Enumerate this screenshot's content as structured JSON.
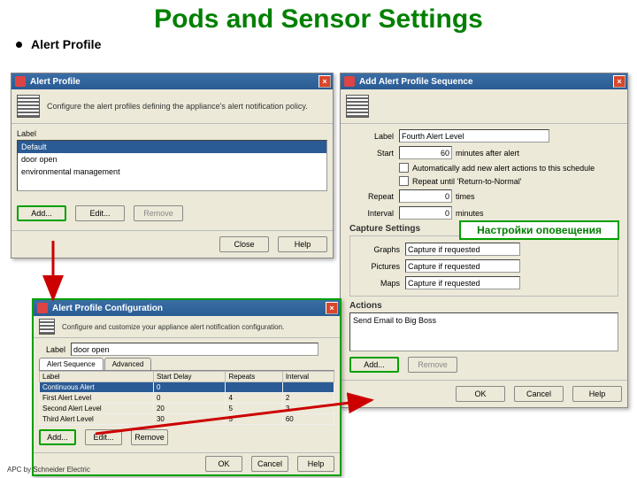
{
  "slide": {
    "title": "Pods and Sensor Settings",
    "bullet": "Alert Profile"
  },
  "footer": "APC by Schneider Electric",
  "annot": {
    "capture": "Настройки оповещения"
  },
  "win1": {
    "title": "Alert Profile",
    "desc": "Configure the alert profiles defining the appliance's alert notification policy.",
    "label_heading": "Label",
    "rows": [
      "Default",
      "door open",
      "environmental management"
    ],
    "buttons": {
      "add": "Add...",
      "edit": "Edit...",
      "remove": "Remove",
      "close": "Close",
      "help": "Help"
    }
  },
  "win2": {
    "title": "Add Alert Profile Sequence",
    "fields": {
      "label_lab": "Label",
      "label_val": "Fourth Alert Level",
      "start_lab": "Start",
      "start_val": "60",
      "start_unit": "minutes after alert",
      "auto_add": "Automatically add new alert actions to this schedule",
      "repeat_until": "Repeat until 'Return-to-Normal'",
      "repeat_lab": "Repeat",
      "repeat_val": "0",
      "repeat_unit": "times",
      "interval_lab": "Interval",
      "interval_val": "0",
      "interval_unit": "minutes"
    },
    "capture_heading": "Capture Settings",
    "capture": {
      "graphs_lab": "Graphs",
      "graphs_val": "Capture if requested",
      "pictures_lab": "Pictures",
      "pictures_val": "Capture if requested",
      "maps_lab": "Maps",
      "maps_val": "Capture if requested"
    },
    "actions_heading": "Actions",
    "action_item": "Send Email to Big Boss",
    "buttons": {
      "add": "Add...",
      "remove": "Remove",
      "ok": "OK",
      "cancel": "Cancel",
      "help": "Help"
    }
  },
  "win3": {
    "title": "Alert Profile Configuration",
    "desc": "Configure and customize your appliance alert notification configuration.",
    "label_lab": "Label",
    "label_val": "door open",
    "tabs": [
      "Alert Sequence",
      "Advanced"
    ],
    "cols": [
      "Label",
      "Start Delay",
      "Repeats",
      "Interval"
    ],
    "rows": [
      [
        "Continuous Alert",
        "0",
        "",
        ""
      ],
      [
        "First Alert Level",
        "0",
        "4",
        "2"
      ],
      [
        "Second Alert Level",
        "20",
        "5",
        "3"
      ],
      [
        "Third Alert Level",
        "30",
        "5",
        "60"
      ]
    ],
    "buttons": {
      "add": "Add...",
      "edit": "Edit...",
      "remove": "Remove",
      "ok": "OK",
      "cancel": "Cancel",
      "help": "Help"
    }
  }
}
